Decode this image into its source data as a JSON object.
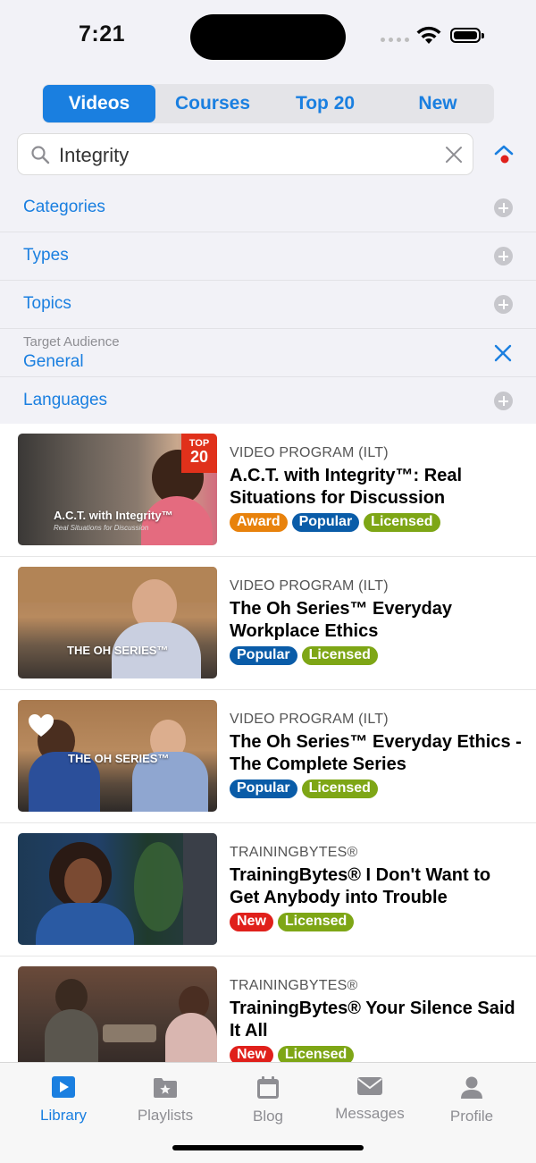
{
  "status_bar": {
    "time": "7:21"
  },
  "segments": [
    {
      "label": "Videos",
      "active": true
    },
    {
      "label": "Courses",
      "active": false
    },
    {
      "label": "Top 20",
      "active": false
    },
    {
      "label": "New",
      "active": false
    }
  ],
  "search": {
    "value": "Integrity",
    "placeholder": "Search"
  },
  "filters": {
    "categories": "Categories",
    "types": "Types",
    "topics": "Topics",
    "audience_caption": "Target Audience",
    "audience_value": "General",
    "languages": "Languages"
  },
  "items": [
    {
      "category": "VIDEO PROGRAM (ILT)",
      "title": "A.C.T. with Integrity™: Real Situations for Discussion",
      "badges": [
        "Award",
        "Popular",
        "Licensed"
      ],
      "thumb_title": "A.C.T. with Integrity™",
      "thumb_sub": "Real Situations for Discussion",
      "ribbon_top": "TOP",
      "ribbon_num": "20"
    },
    {
      "category": "VIDEO PROGRAM (ILT)",
      "title": "The Oh Series™ Everyday Workplace Ethics",
      "badges": [
        "Popular",
        "Licensed"
      ],
      "thumb_title": "THE OH SERIES™"
    },
    {
      "category": "VIDEO PROGRAM (ILT)",
      "title": "The Oh Series™ Everyday Ethics - The Complete Series",
      "badges": [
        "Popular",
        "Licensed"
      ],
      "thumb_title": "THE OH SERIES™"
    },
    {
      "category": "TRAININGBYTES®",
      "title": "TrainingBytes® I Don't Want to Get Anybody into Trouble",
      "badges": [
        "New",
        "Licensed"
      ]
    },
    {
      "category": "TRAININGBYTES®",
      "title": "TrainingBytes® Your Silence Said It All",
      "badges": [
        "New",
        "Licensed"
      ]
    }
  ],
  "tabbar": {
    "library": "Library",
    "playlists": "Playlists",
    "blog": "Blog",
    "messages": "Messages",
    "profile": "Profile"
  },
  "colors": {
    "accent": "#1a7fe0",
    "award": "#e8820c",
    "popular": "#0a5ca8",
    "licensed": "#7ea616",
    "new": "#e0201b"
  }
}
